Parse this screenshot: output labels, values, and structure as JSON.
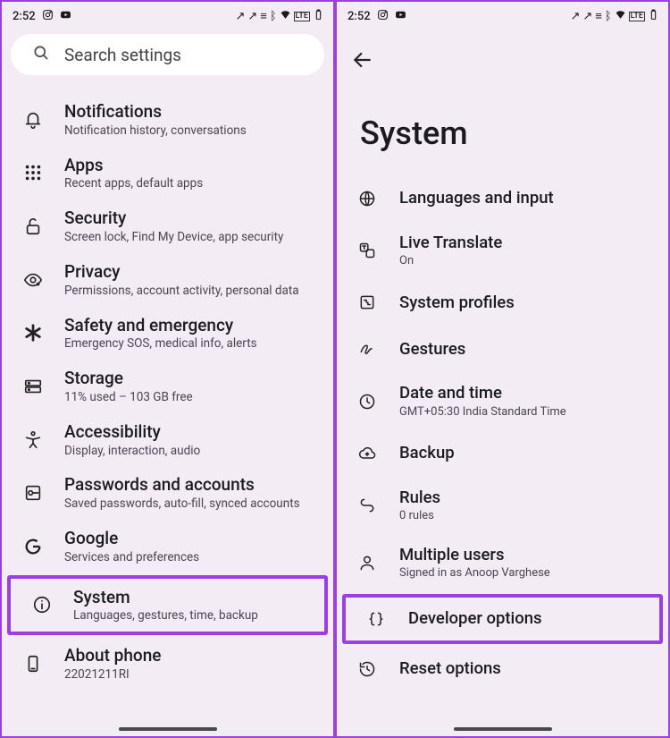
{
  "status": {
    "time": "2:52",
    "app_icons": [
      "instagram",
      "youtube"
    ],
    "right_icons": [
      "call-out",
      "call-out",
      "vibrate",
      "bluetooth",
      "wifi",
      "signal-lte",
      "battery"
    ]
  },
  "left_screen": {
    "search_placeholder": "Search settings",
    "items": [
      {
        "id": "notifications",
        "title": "Notifications",
        "sub": "Notification history, conversations",
        "icon": "bell-icon"
      },
      {
        "id": "apps",
        "title": "Apps",
        "sub": "Recent apps, default apps",
        "icon": "apps-grid-icon"
      },
      {
        "id": "security",
        "title": "Security",
        "sub": "Screen lock, Find My Device, app security",
        "icon": "lock-open-icon"
      },
      {
        "id": "privacy",
        "title": "Privacy",
        "sub": "Permissions, account activity, personal data",
        "icon": "eye-lock-icon"
      },
      {
        "id": "safety",
        "title": "Safety and emergency",
        "sub": "Emergency SOS, medical info, alerts",
        "icon": "asterisk-icon"
      },
      {
        "id": "storage",
        "title": "Storage",
        "sub": "11% used – 103 GB free",
        "icon": "storage-icon"
      },
      {
        "id": "accessibility",
        "title": "Accessibility",
        "sub": "Display, interaction, audio",
        "icon": "accessibility-icon"
      },
      {
        "id": "passwords",
        "title": "Passwords and accounts",
        "sub": "Saved passwords, auto-fill, synced accounts",
        "icon": "passwords-icon"
      },
      {
        "id": "google",
        "title": "Google",
        "sub": "Services and preferences",
        "icon": "google-icon"
      },
      {
        "id": "system",
        "title": "System",
        "sub": "Languages, gestures, time, backup",
        "icon": "info-icon",
        "highlight": true
      },
      {
        "id": "about",
        "title": "About phone",
        "sub": "22021211RI",
        "icon": "phone-device-icon"
      }
    ]
  },
  "right_screen": {
    "page_title": "System",
    "items": [
      {
        "id": "langs",
        "title": "Languages and input",
        "sub": "",
        "icon": "globe-icon"
      },
      {
        "id": "livetranslate",
        "title": "Live Translate",
        "sub": "On",
        "icon": "translate-icon"
      },
      {
        "id": "profiles",
        "title": "System profiles",
        "sub": "",
        "icon": "profile-icon"
      },
      {
        "id": "gestures",
        "title": "Gestures",
        "sub": "",
        "icon": "gesture-icon"
      },
      {
        "id": "datetime",
        "title": "Date and time",
        "sub": "GMT+05:30 India Standard Time",
        "icon": "clock-icon"
      },
      {
        "id": "backup",
        "title": "Backup",
        "sub": "",
        "icon": "cloud-up-icon"
      },
      {
        "id": "rules",
        "title": "Rules",
        "sub": "0 rules",
        "icon": "rules-icon"
      },
      {
        "id": "multiusers",
        "title": "Multiple users",
        "sub": "Signed in as Anoop Varghese",
        "icon": "person-icon"
      },
      {
        "id": "devopts",
        "title": "Developer options",
        "sub": "",
        "icon": "braces-icon",
        "highlight": true
      },
      {
        "id": "reset",
        "title": "Reset options",
        "sub": "",
        "icon": "history-icon"
      }
    ]
  }
}
